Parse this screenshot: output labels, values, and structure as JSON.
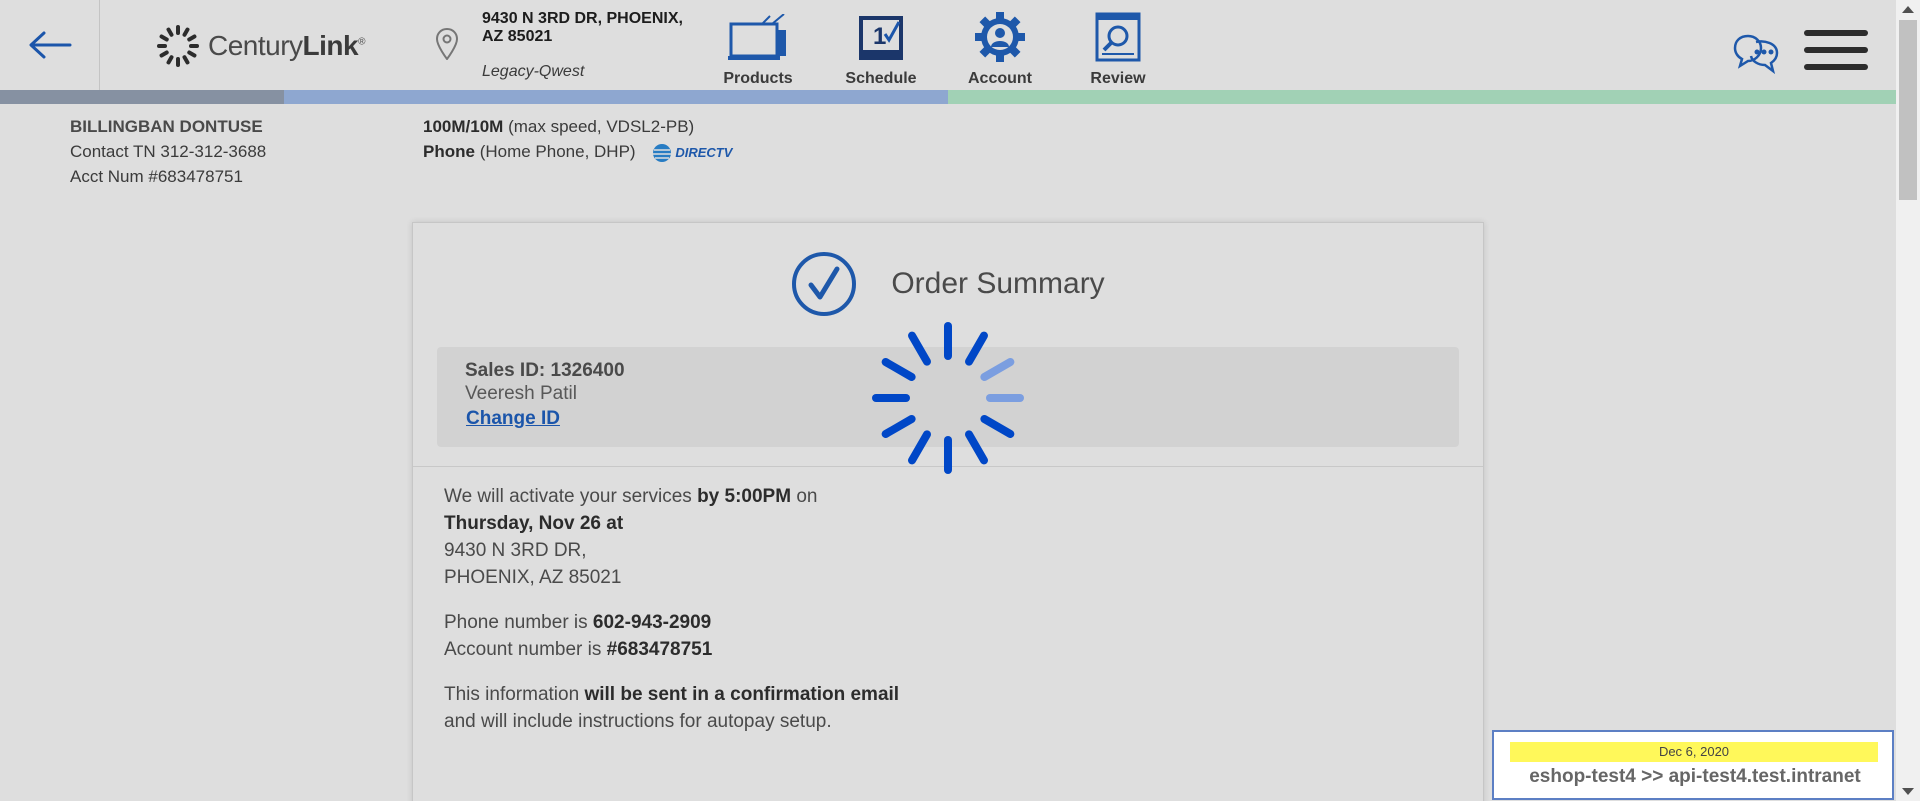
{
  "header": {
    "brand": {
      "name_regular": "Century",
      "name_bold": "Link",
      "mark": "®"
    },
    "address_line1": "9430 N 3RD DR, PHOENIX,",
    "address_line2": "AZ 85021",
    "region": "Legacy-Qwest",
    "nav": [
      {
        "label": "Products",
        "icon": "tv-icon"
      },
      {
        "label": "Schedule",
        "icon": "calendar-icon",
        "badge": "1"
      },
      {
        "label": "Account",
        "icon": "gear-user-icon"
      },
      {
        "label": "Review",
        "icon": "review-search-icon"
      }
    ]
  },
  "progress_colors": [
    "#9aa7bb",
    "#a4c0ef",
    "#b9f0d0"
  ],
  "customer": {
    "name": "BILLINGBAN DONTUSE",
    "contact": "Contact TN 312-312-3688",
    "account": "Acct Num #683478751"
  },
  "services": {
    "internet_bold": "100M/10M",
    "internet_detail": "(max speed, VDSL2-PB)",
    "phone_bold": "Phone",
    "phone_detail": "(Home Phone, DHP)",
    "partner_logo": "DIRECTV"
  },
  "summary": {
    "title": "Order Summary",
    "sales_id": "Sales ID: 1326400",
    "agent": "Veeresh Patil",
    "change_id": "Change ID"
  },
  "body": {
    "p1_a": "We will activate your services ",
    "p1_b": "by 5:00PM",
    "p1_c": " on ",
    "p1_d": "Thursday, Nov 26 at",
    "p1_e": "9430 N 3RD DR,",
    "p1_f": "PHOENIX, AZ 85021",
    "p2_a": "Phone number is ",
    "p2_b": "602-943-2909",
    "p2_c": "Account number is ",
    "p2_d": "#683478751",
    "p3_a": "This information ",
    "p3_b": "will be sent in a confirmation email",
    "p3_c": " and will include instructions for autopay setup."
  },
  "env": {
    "date": "Dec 6, 2020",
    "text": "eshop-test4 >> api-test4.test.intranet"
  },
  "colors": {
    "brand_blue": "#1f62c4",
    "spinner_blue": "#0047c7",
    "highlight_yellow": "#fff85a"
  }
}
